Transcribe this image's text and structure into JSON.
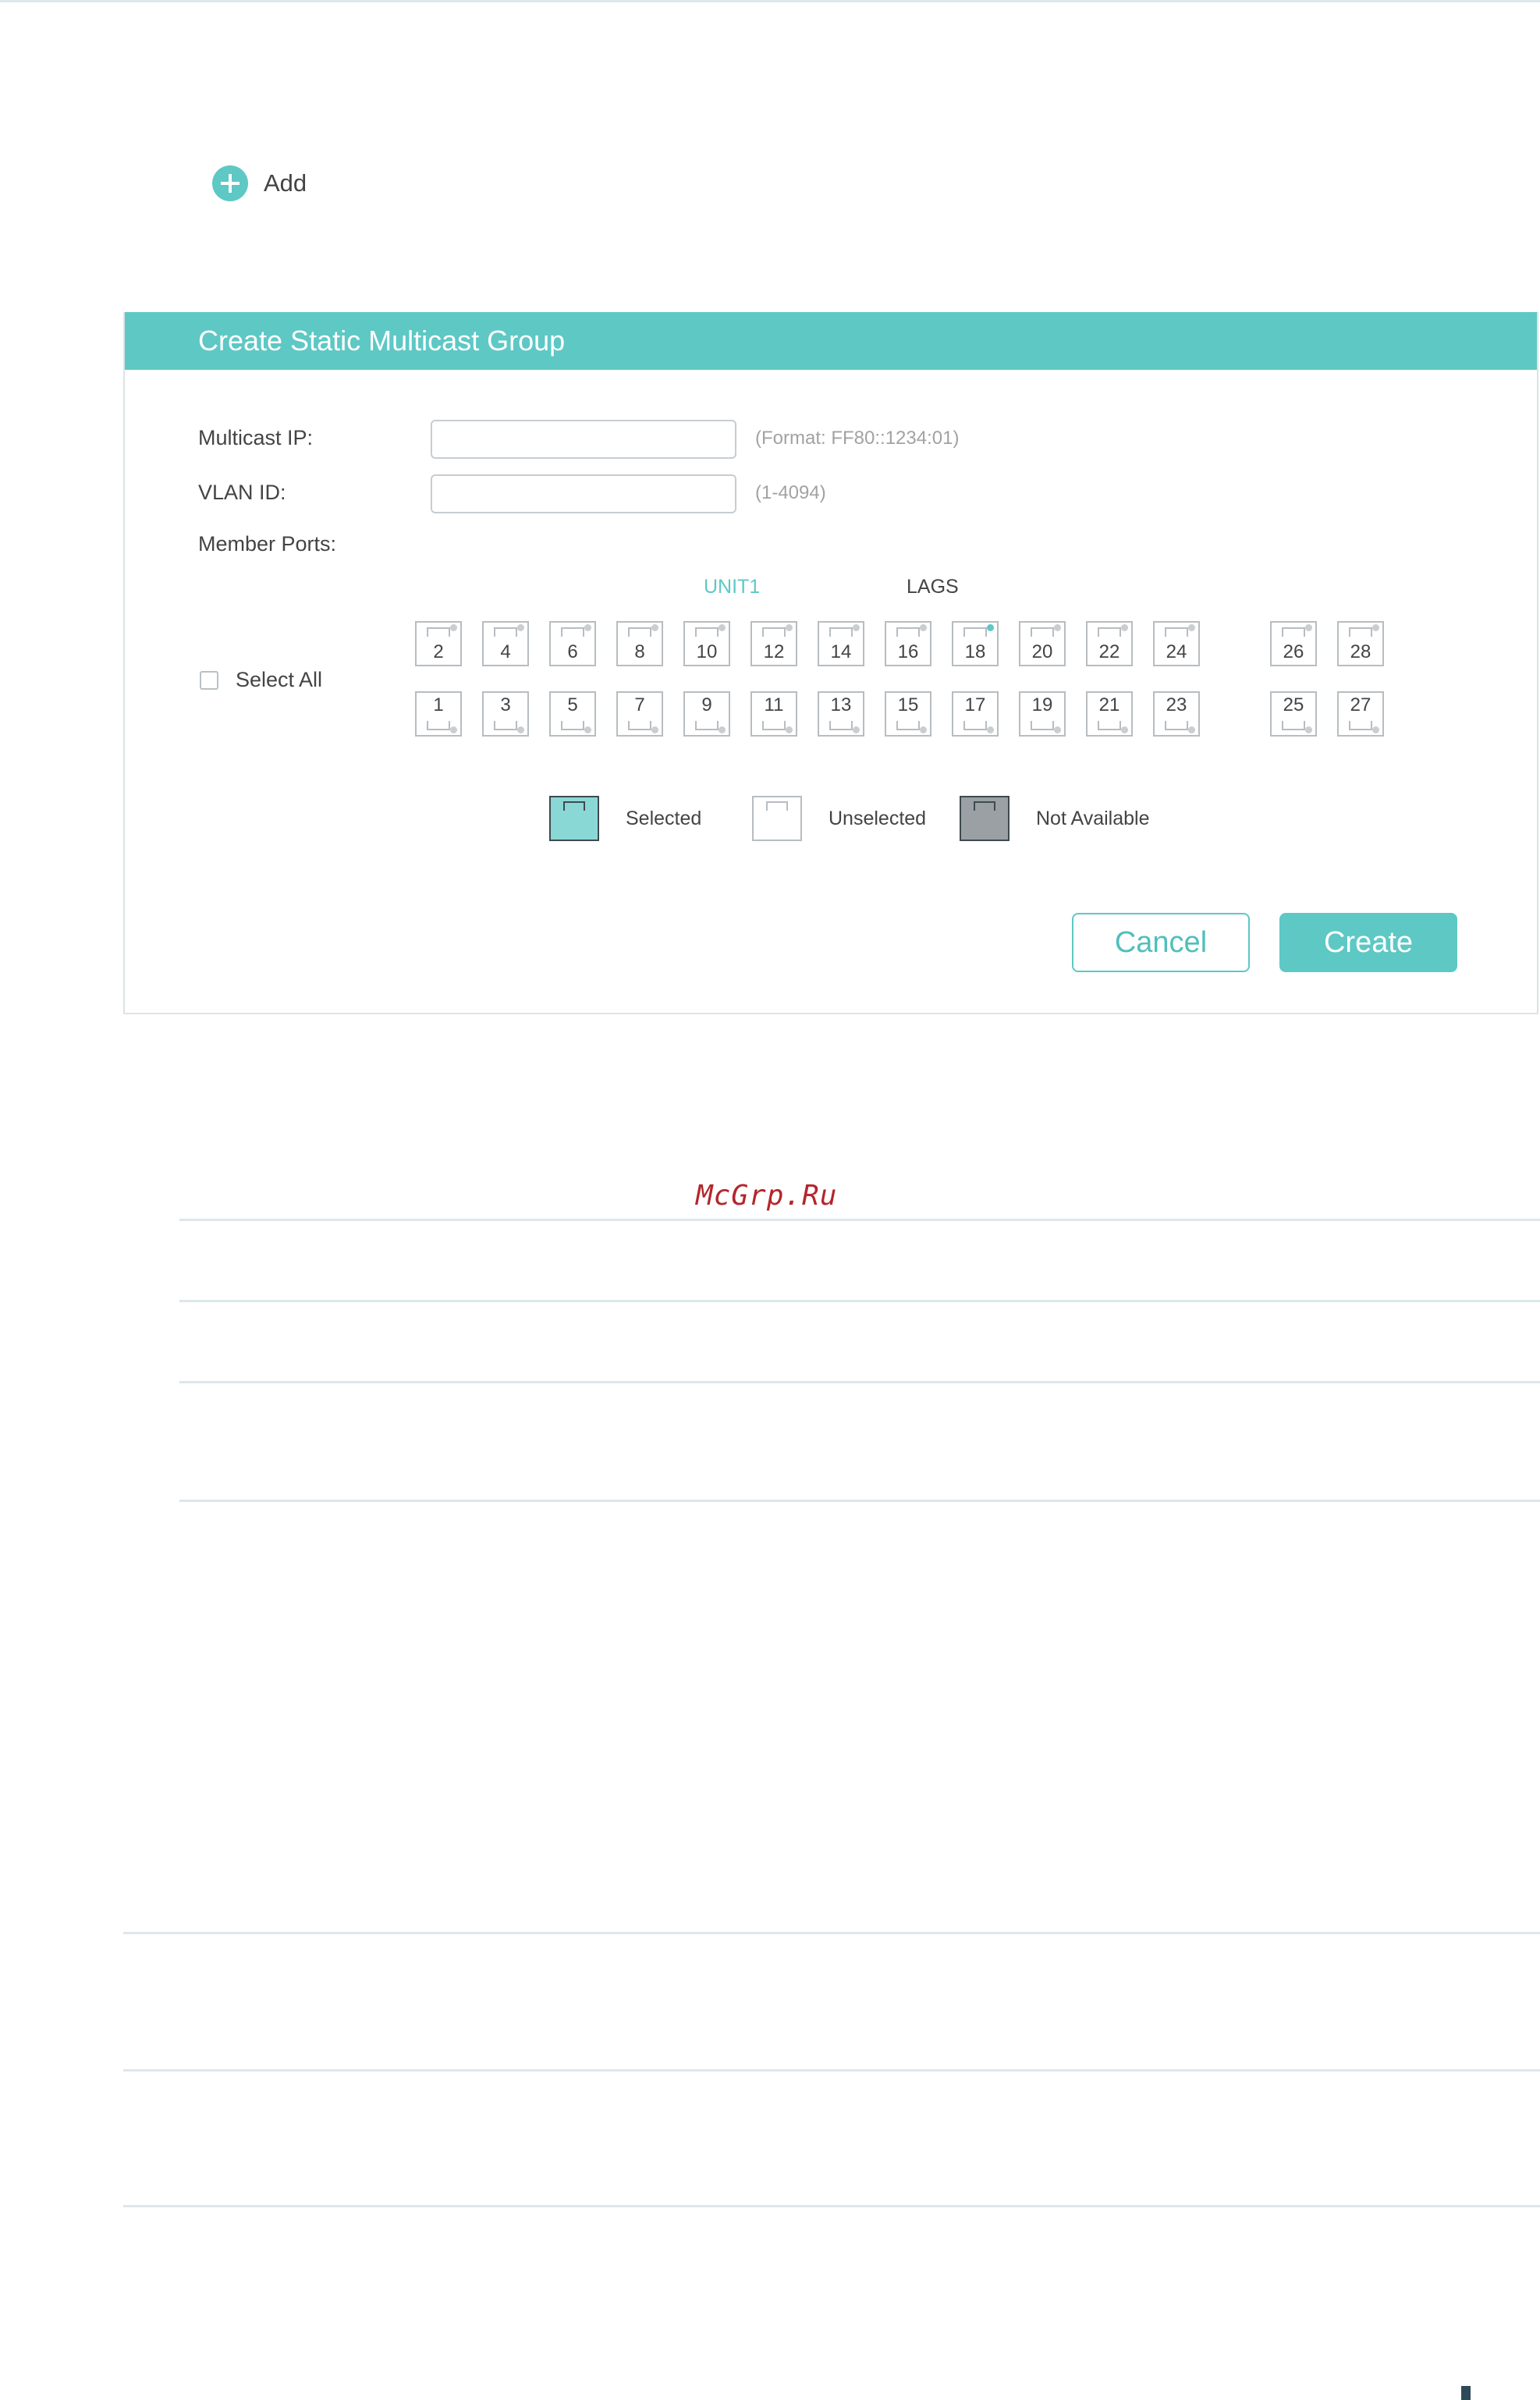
{
  "add_button": {
    "label": "Add",
    "icon": "plus-circle-icon"
  },
  "dialog": {
    "title": "Create Static Multicast Group",
    "multicast_ip": {
      "label": "Multicast IP:",
      "value": "",
      "hint": "(Format: FF80::1234:01)"
    },
    "vlan_id": {
      "label": "VLAN ID:",
      "value": "",
      "hint": "(1-4094)"
    },
    "member_ports": {
      "label": "Member Ports:",
      "unit_label": "UNIT1",
      "lags_label": "LAGS",
      "select_all_label": "Select All",
      "top_row": [
        "2",
        "4",
        "6",
        "8",
        "10",
        "12",
        "14",
        "16",
        "18",
        "20",
        "22",
        "24",
        "26",
        "28"
      ],
      "bottom_row": [
        "1",
        "3",
        "5",
        "7",
        "9",
        "11",
        "13",
        "15",
        "17",
        "19",
        "21",
        "23",
        "25",
        "27"
      ],
      "active_ports": [
        "18"
      ]
    },
    "legend": {
      "selected": "Selected",
      "unselected": "Unselected",
      "not_available": "Not Available"
    },
    "cancel_label": "Cancel",
    "create_label": "Create"
  },
  "watermark": "McGrp.Ru",
  "colors": {
    "accent": "#5ec8c5",
    "watermark": "#b3262c"
  }
}
